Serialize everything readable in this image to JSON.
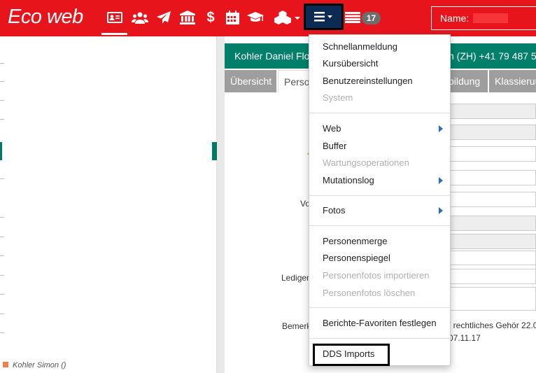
{
  "header": {
    "logo": "Eco web",
    "nav_icons": [
      "person-card-icon",
      "group-icon",
      "paper-plane-icon",
      "bank-icon",
      "dollar-icon",
      "calendar-icon",
      "graduation-cap-icon",
      "cubes-icon",
      "hamburger-menu-icon",
      "list-icon"
    ],
    "badge_count": "17",
    "name_label": "Name:"
  },
  "person": {
    "name_fragment": "Kohler Daniel Flo",
    "contact_fragment": "h (ZH) +41 79 487 5"
  },
  "tabs": [
    {
      "label": "Übersicht"
    },
    {
      "label": "Perso"
    },
    {
      "label": "bildung"
    },
    {
      "label": "Klassierun"
    }
  ],
  "form": {
    "label_vo": "Vo",
    "label_ledigen": "Ledigen",
    "label_bemerk": "Bemerk",
    "remark_line1": "/ rechtliches Gehör 22.0",
    "remark_line2": "07.11.17"
  },
  "left": {
    "bottom_item": "Kohler Simon ()"
  },
  "dropdown": {
    "items": [
      {
        "label": "Schnellanmeldung",
        "disabled": false,
        "submenu": false
      },
      {
        "label": "Kursübersicht",
        "disabled": false,
        "submenu": false
      },
      {
        "label": "Benutzereinstellungen",
        "disabled": false,
        "submenu": false
      },
      {
        "label": "System",
        "disabled": true,
        "submenu": false
      },
      {
        "label": "Web",
        "disabled": false,
        "submenu": true
      },
      {
        "label": "Buffer",
        "disabled": false,
        "submenu": false
      },
      {
        "label": "Wartungsoperationen",
        "disabled": true,
        "submenu": false
      },
      {
        "label": "Mutationslog",
        "disabled": false,
        "submenu": true
      },
      {
        "label": "Fotos",
        "disabled": false,
        "submenu": true
      },
      {
        "label": "Personenmerge",
        "disabled": false,
        "submenu": false
      },
      {
        "label": "Personenspiegel",
        "disabled": false,
        "submenu": false
      },
      {
        "label": "Personenfotos importieren",
        "disabled": true,
        "submenu": false
      },
      {
        "label": "Personenfotos löschen",
        "disabled": true,
        "submenu": false
      },
      {
        "label": "Berichte-Favoriten festlegen",
        "disabled": false,
        "submenu": false
      },
      {
        "label": "DDS Imports",
        "disabled": false,
        "submenu": false
      }
    ]
  },
  "colors": {
    "brand_red": "#e8141b",
    "accent_green": "#00806a",
    "menu_button_bg": "#0b2a54"
  }
}
